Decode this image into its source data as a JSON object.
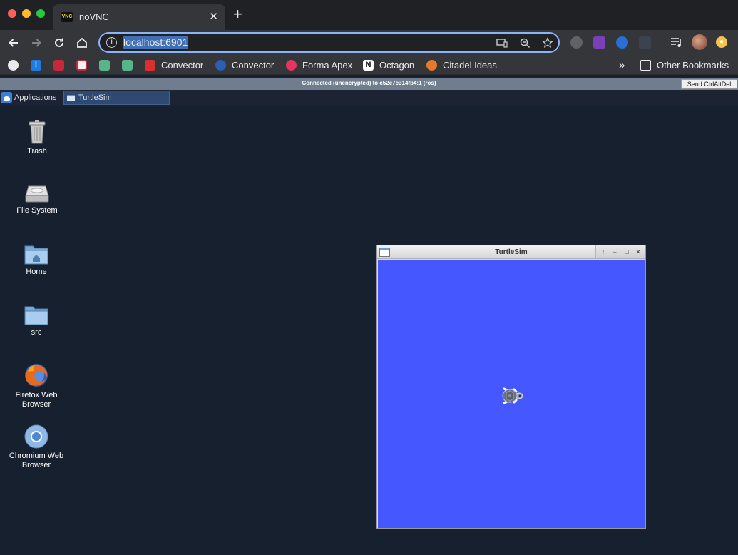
{
  "browser": {
    "tab_title": "noVNC",
    "tab_favicon_text": "VNC",
    "url": "localhost:6901",
    "bookmarks": [
      {
        "label": "",
        "icon": "github-icon"
      },
      {
        "label": "",
        "icon": "exclamation-icon"
      },
      {
        "label": "",
        "icon": "red-app-icon"
      },
      {
        "label": "",
        "icon": "red-app-icon-2"
      },
      {
        "label": "",
        "icon": "green-cube-icon"
      },
      {
        "label": "",
        "icon": "green-cube-icon-2"
      },
      {
        "label": "Convector",
        "icon": "convector-red-icon"
      },
      {
        "label": "Convector",
        "icon": "convector-blue-icon"
      },
      {
        "label": "Forma Apex",
        "icon": "forma-apex-icon"
      },
      {
        "label": "Octagon",
        "icon": "notion-icon"
      },
      {
        "label": "Citadel Ideas",
        "icon": "citadel-icon"
      }
    ],
    "other_bookmarks_label": "Other Bookmarks",
    "overflow_label": "»"
  },
  "novnc": {
    "status_text": "Connected (unencrypted) to e52e7c314fb4:1 (ros)",
    "ctrl_alt_del_label": "Send CtrlAltDel"
  },
  "desktop": {
    "applications_label": "Applications",
    "taskbar_item_label": "TurtleSim",
    "icons": {
      "trash": "Trash",
      "filesystem": "File System",
      "home": "Home",
      "src": "src",
      "firefox": "Firefox Web Browser",
      "chromium": "Chromium Web Browser"
    }
  },
  "turtlesim": {
    "title": "TurtleSim",
    "background_color": "#4557ff"
  },
  "colors": {
    "desktop_bg": "#16202e",
    "chrome_dark": "#202124",
    "chrome_toolbar": "#35363a",
    "omnibox_focus": "#8ab4f8"
  }
}
